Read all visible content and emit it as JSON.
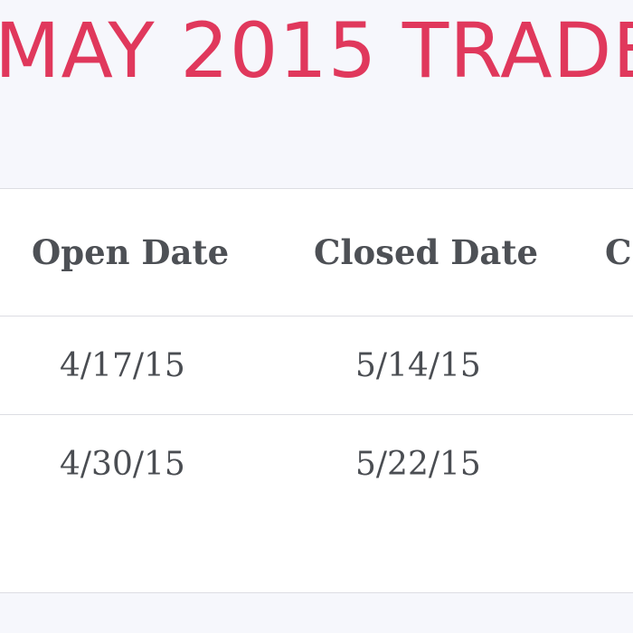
{
  "page": {
    "title": "MAY 2015 TRADE"
  },
  "table": {
    "headers": [
      "Open Date",
      "Closed Date",
      "C"
    ],
    "rows": [
      {
        "open_date": "4/17/15",
        "closed_date": "5/14/15"
      },
      {
        "open_date": "4/30/15",
        "closed_date": "5/22/15"
      }
    ]
  },
  "colors": {
    "title": "#e0385c",
    "background": "#f6f7fc",
    "card": "#ffffff",
    "border": "#dcdde3",
    "text": "#4a4d52"
  }
}
